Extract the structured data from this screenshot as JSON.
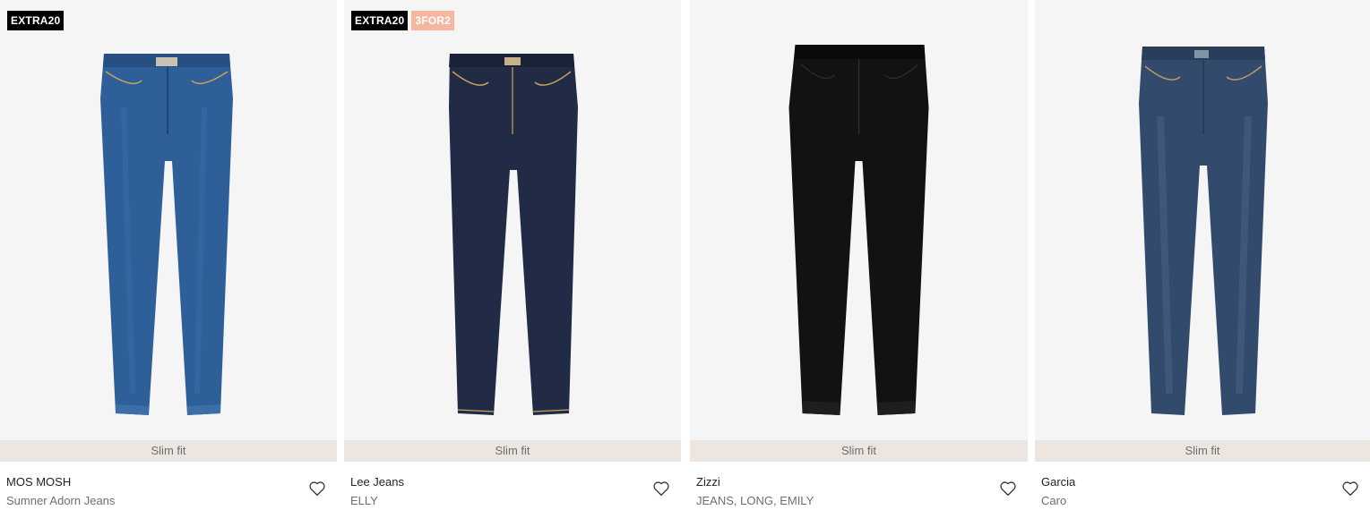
{
  "products": [
    {
      "badges": [
        "EXTRA20"
      ],
      "fit": "Slim fit",
      "brand": "MOS MOSH",
      "model": "Sumner Adorn Jeans",
      "wash_color": "#2f5f99"
    },
    {
      "badges": [
        "EXTRA20",
        "3FOR2"
      ],
      "fit": "Slim fit",
      "brand": "Lee Jeans",
      "model": "ELLY",
      "wash_color": "#222b46"
    },
    {
      "badges": [],
      "fit": "Slim fit",
      "brand": "Zizzi",
      "model": "JEANS, LONG, EMILY",
      "wash_color": "#121212"
    },
    {
      "badges": [],
      "fit": "Slim fit",
      "brand": "Garcia",
      "model": "Caro",
      "wash_color": "#324a6c"
    }
  ],
  "icons": {
    "favorite": "heart-outline-icon"
  },
  "colors": {
    "badge_dark": "#000000",
    "badge_peach": "#f5b7a0",
    "fit_bar": "#ede6e0",
    "image_bg": "#f5f5f5"
  }
}
